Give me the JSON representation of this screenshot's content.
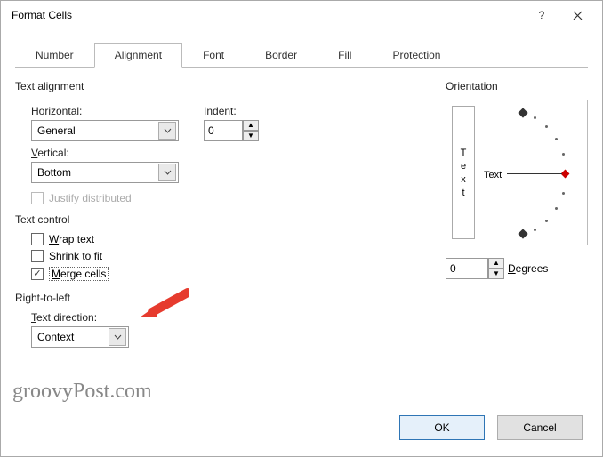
{
  "title": "Format Cells",
  "tabs": [
    "Number",
    "Alignment",
    "Font",
    "Border",
    "Fill",
    "Protection"
  ],
  "activeTab": "Alignment",
  "sections": {
    "textAlignment": "Text alignment",
    "horizontalLabel": "Horizontal:",
    "horizontalValue": "General",
    "verticalLabel": "Vertical:",
    "verticalValue": "Bottom",
    "indentLabel": "Indent:",
    "indentValue": "0",
    "justifyDistributed": "Justify distributed",
    "textControl": "Text control",
    "wrapText": "Wrap text",
    "shrinkToFit": "Shrink to fit",
    "mergeCells": "Merge cells",
    "rightToLeft": "Right-to-left",
    "textDirectionLabel": "Text direction:",
    "textDirectionValue": "Context",
    "orientation": "Orientation",
    "orientationText": "Text",
    "degreesValue": "0",
    "degreesLabel": "Degrees"
  },
  "buttons": {
    "ok": "OK",
    "cancel": "Cancel"
  },
  "watermark": "groovyPost.com"
}
